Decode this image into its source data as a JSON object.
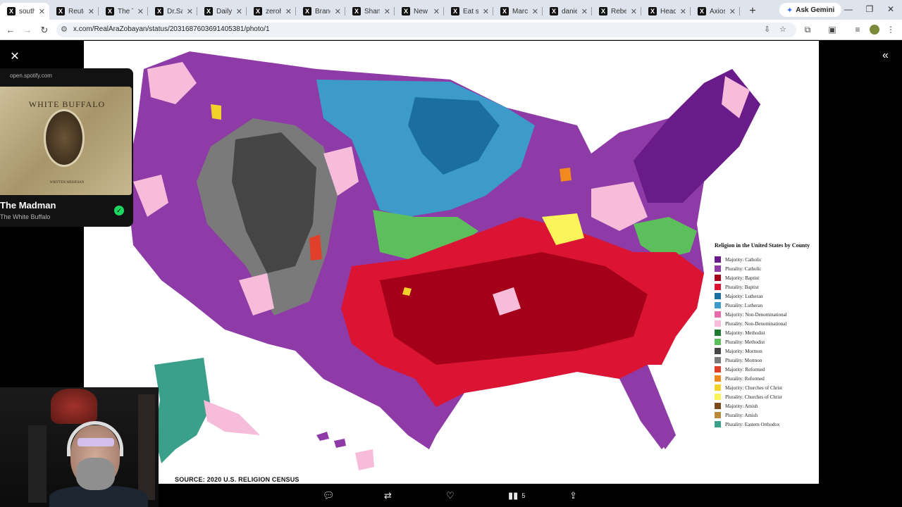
{
  "tabs": [
    {
      "title": "south",
      "active": true
    },
    {
      "title": "Reute",
      "active": false
    },
    {
      "title": "The Tr",
      "active": false
    },
    {
      "title": "Dr.San",
      "active": false
    },
    {
      "title": "Daily",
      "active": false
    },
    {
      "title": "zeroh",
      "active": false
    },
    {
      "title": "Brand",
      "active": false
    },
    {
      "title": "Shana",
      "active": false
    },
    {
      "title": "New Y",
      "active": false
    },
    {
      "title": "Eat sc",
      "active": false
    },
    {
      "title": "March",
      "active": false
    },
    {
      "title": "daniel",
      "active": false
    },
    {
      "title": "Rebel",
      "active": false
    },
    {
      "title": "Head",
      "active": false
    },
    {
      "title": "Axios",
      "active": false
    }
  ],
  "ask_gemini": "Ask Gemini",
  "address_bar": {
    "url": "x.com/RealAraZobayan/status/2031687603691405381/photo/1"
  },
  "photo": {
    "source_text": "SOURCE: 2020 U.S. RELIGION CENSUS",
    "legend_title": "Religion in the United States by County",
    "legend": [
      {
        "label": "Majority: Catholic",
        "color": "#6a1b8a"
      },
      {
        "label": "Plurality: Catholic",
        "color": "#8e3aa7"
      },
      {
        "label": "Majority: Baptist",
        "color": "#a5001a"
      },
      {
        "label": "Plurality: Baptist",
        "color": "#dc1433"
      },
      {
        "label": "Majority: Lutheran",
        "color": "#1a6fa0"
      },
      {
        "label": "Plurality: Lutheran",
        "color": "#3d9bc9"
      },
      {
        "label": "Majority: Non-Denominational",
        "color": "#e86aa8"
      },
      {
        "label": "Plurality: Non-Denominational",
        "color": "#f6bcd9"
      },
      {
        "label": "Majority: Methodist",
        "color": "#1e7a32"
      },
      {
        "label": "Plurality: Methodist",
        "color": "#5cbf5c"
      },
      {
        "label": "Majority: Mormon",
        "color": "#454545"
      },
      {
        "label": "Plurality: Mormon",
        "color": "#7a7a7a"
      },
      {
        "label": "Majority: Reformed",
        "color": "#e0402a"
      },
      {
        "label": "Plurality: Reformed",
        "color": "#f08a1e"
      },
      {
        "label": "Majority: Churches of Christ",
        "color": "#f2d22a"
      },
      {
        "label": "Plurality: Churches of Christ",
        "color": "#fbf35a"
      },
      {
        "label": "Majority: Amish",
        "color": "#7a4a18"
      },
      {
        "label": "Plurality: Amish",
        "color": "#b88a3a"
      },
      {
        "label": "Plurality: Eastern Orthodox",
        "color": "#3aa08a"
      }
    ]
  },
  "actions": {
    "views_count": "5"
  },
  "spotify": {
    "source": "open.spotify.com",
    "album_title": "WHITE BUFFALO",
    "album_subtitle": "WRITTEN MERIDIAN",
    "song": "The Madman",
    "artist": "The White Buffalo"
  }
}
